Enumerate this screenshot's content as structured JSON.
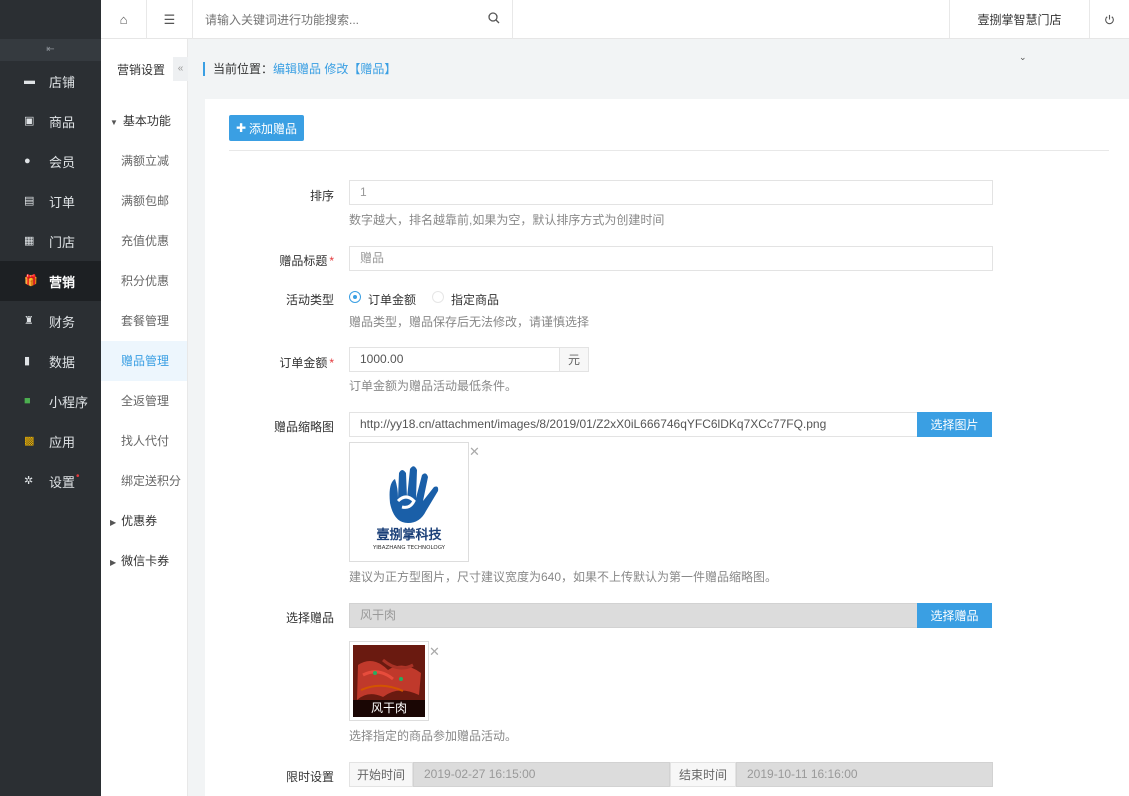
{
  "topbar": {
    "search_placeholder": "请输入关键词进行功能搜索...",
    "store_name": "壹捌掌智慧门店"
  },
  "sidebar": {
    "items": [
      {
        "label": "店铺",
        "icon": "store-icon"
      },
      {
        "label": "商品",
        "icon": "goods-icon"
      },
      {
        "label": "会员",
        "icon": "user-icon"
      },
      {
        "label": "订单",
        "icon": "order-icon"
      },
      {
        "label": "门店",
        "icon": "shop-icon"
      },
      {
        "label": "营销",
        "icon": "gift-icon",
        "active": true
      },
      {
        "label": "财务",
        "icon": "finance-icon"
      },
      {
        "label": "数据",
        "icon": "chart-icon"
      },
      {
        "label": "小程序",
        "icon": "miniapp-icon"
      },
      {
        "label": "应用",
        "icon": "apps-icon"
      },
      {
        "label": "设置",
        "icon": "gear-icon"
      }
    ]
  },
  "subnav": {
    "title": "营销设置",
    "group_basic": "基本功能",
    "links": [
      "满额立减",
      "满额包邮",
      "充值优惠",
      "积分优惠",
      "套餐管理",
      "赠品管理",
      "全返管理",
      "找人代付",
      "绑定送积分"
    ],
    "group_coupon": "优惠券",
    "group_wxcard": "微信卡券"
  },
  "breadcrumb": {
    "prefix": "当前位置：",
    "path": "编辑赠品 修改【赠品】"
  },
  "form": {
    "add_button": "添加赠品",
    "sort": {
      "label": "排序",
      "value": "1",
      "help": "数字越大，排名越靠前,如果为空，默认排序方式为创建时间"
    },
    "title": {
      "label": "赠品标题",
      "value": "赠品"
    },
    "type": {
      "label": "活动类型",
      "option1": "订单金额",
      "option2": "指定商品",
      "help": "赠品类型，赠品保存后无法修改，请谨慎选择"
    },
    "amount": {
      "label": "订单金额",
      "value": "1000.00",
      "unit": "元",
      "help": "订单金额为赠品活动最低条件。"
    },
    "thumb": {
      "label": "赠品缩略图",
      "url": "http://yy18.cn/attachment/images/8/2019/01/Z2xX0iL666746qYFC6lDKq7XCc77FQ.png",
      "button": "选择图片",
      "logo_text": "壹捌掌科技",
      "logo_sub": "YIBAZHANG TECHNOLOGY",
      "help": "建议为正方型图片，尺寸建议宽度为640，如果不上传默认为第一件赠品缩略图。"
    },
    "gift": {
      "label": "选择赠品",
      "value": "风干肉",
      "button": "选择赠品",
      "caption": "风干肉",
      "help": "选择指定的商品参加赠品活动。"
    },
    "time": {
      "label": "限时设置",
      "start_label": "开始时间",
      "start": "2019-02-27 16:15:00",
      "end_label": "结束时间",
      "end": "2019-10-11 16:16:00"
    }
  }
}
